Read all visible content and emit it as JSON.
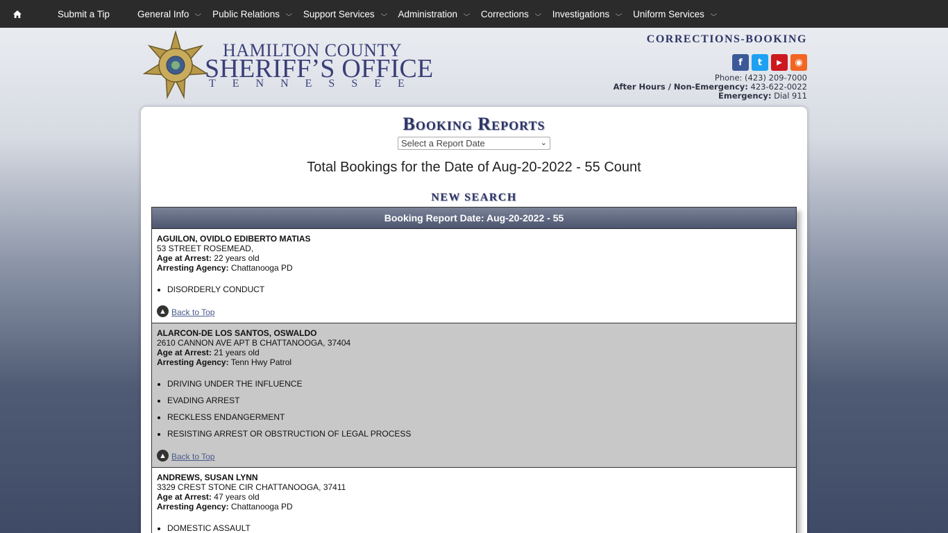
{
  "nav": {
    "home_icon": "home-icon",
    "items": [
      {
        "label": "Submit a Tip",
        "dropdown": false
      },
      {
        "label": "General Info",
        "dropdown": true
      },
      {
        "label": "Public Relations",
        "dropdown": true
      },
      {
        "label": "Support Services",
        "dropdown": true
      },
      {
        "label": "Administration",
        "dropdown": true
      },
      {
        "label": "Corrections",
        "dropdown": true
      },
      {
        "label": "Investigations",
        "dropdown": true
      },
      {
        "label": "Uniform Services",
        "dropdown": true
      }
    ]
  },
  "logo": {
    "line1": "HAMILTON COUNTY",
    "line2": "SHERIFF’S OFFICE",
    "line3": "TENNESSEE",
    "badge_text": "SHERIFF"
  },
  "header": {
    "section": "CORRECTIONS-BOOKING",
    "social": [
      {
        "icon": "facebook-icon",
        "glyph": "f",
        "color": "#3b5998"
      },
      {
        "icon": "twitter-icon",
        "glyph": "t",
        "color": "#1da1f2"
      },
      {
        "icon": "youtube-icon",
        "glyph": "▶",
        "color": "#cc181e"
      },
      {
        "icon": "rss-icon",
        "glyph": "◉",
        "color": "#f26522"
      }
    ],
    "phone_label": "Phone:",
    "phone": "(423) 209-7000",
    "after_hours_label": "After Hours / Non-Emergency:",
    "after_hours": "423-622-0022",
    "emergency_label": "Emergency:",
    "emergency": "Dial 911"
  },
  "main": {
    "title": "Booking Reports",
    "select_placeholder": "Select a Report Date",
    "total": "Total Bookings for the Date of Aug-20-2022 - 55 Count",
    "new_search": "NEW SEARCH",
    "report_header": "Booking Report Date: Aug-20-2022 - 55",
    "age_label": "Age at Arrest:",
    "agency_label": "Arresting Agency:",
    "back_to_top": "Back to Top",
    "records": [
      {
        "name": "AGUILON, OVIDLO EDIBERTO MATIAS",
        "address": "53 STREET ROSEMEAD,",
        "age": "22 years old",
        "agency": "Chattanooga PD",
        "charges": [
          "DISORDERLY CONDUCT"
        ]
      },
      {
        "name": "ALARCON-DE LOS SANTOS, OSWALDO",
        "address": "2610 CANNON AVE APT B CHATTANOOGA, 37404",
        "age": "21 years old",
        "agency": "Tenn Hwy Patrol",
        "charges": [
          "DRIVING UNDER THE INFLUENCE",
          "EVADING ARREST",
          "RECKLESS ENDANGERMENT",
          "RESISTING ARREST OR OBSTRUCTION OF LEGAL PROCESS"
        ]
      },
      {
        "name": "ANDREWS, SUSAN LYNN",
        "address": "3329 CREST STONE CIR CHATTANOOGA, 37411",
        "age": "47 years old",
        "agency": "Chattanooga PD",
        "charges": [
          "DOMESTIC ASSAULT"
        ]
      }
    ]
  }
}
